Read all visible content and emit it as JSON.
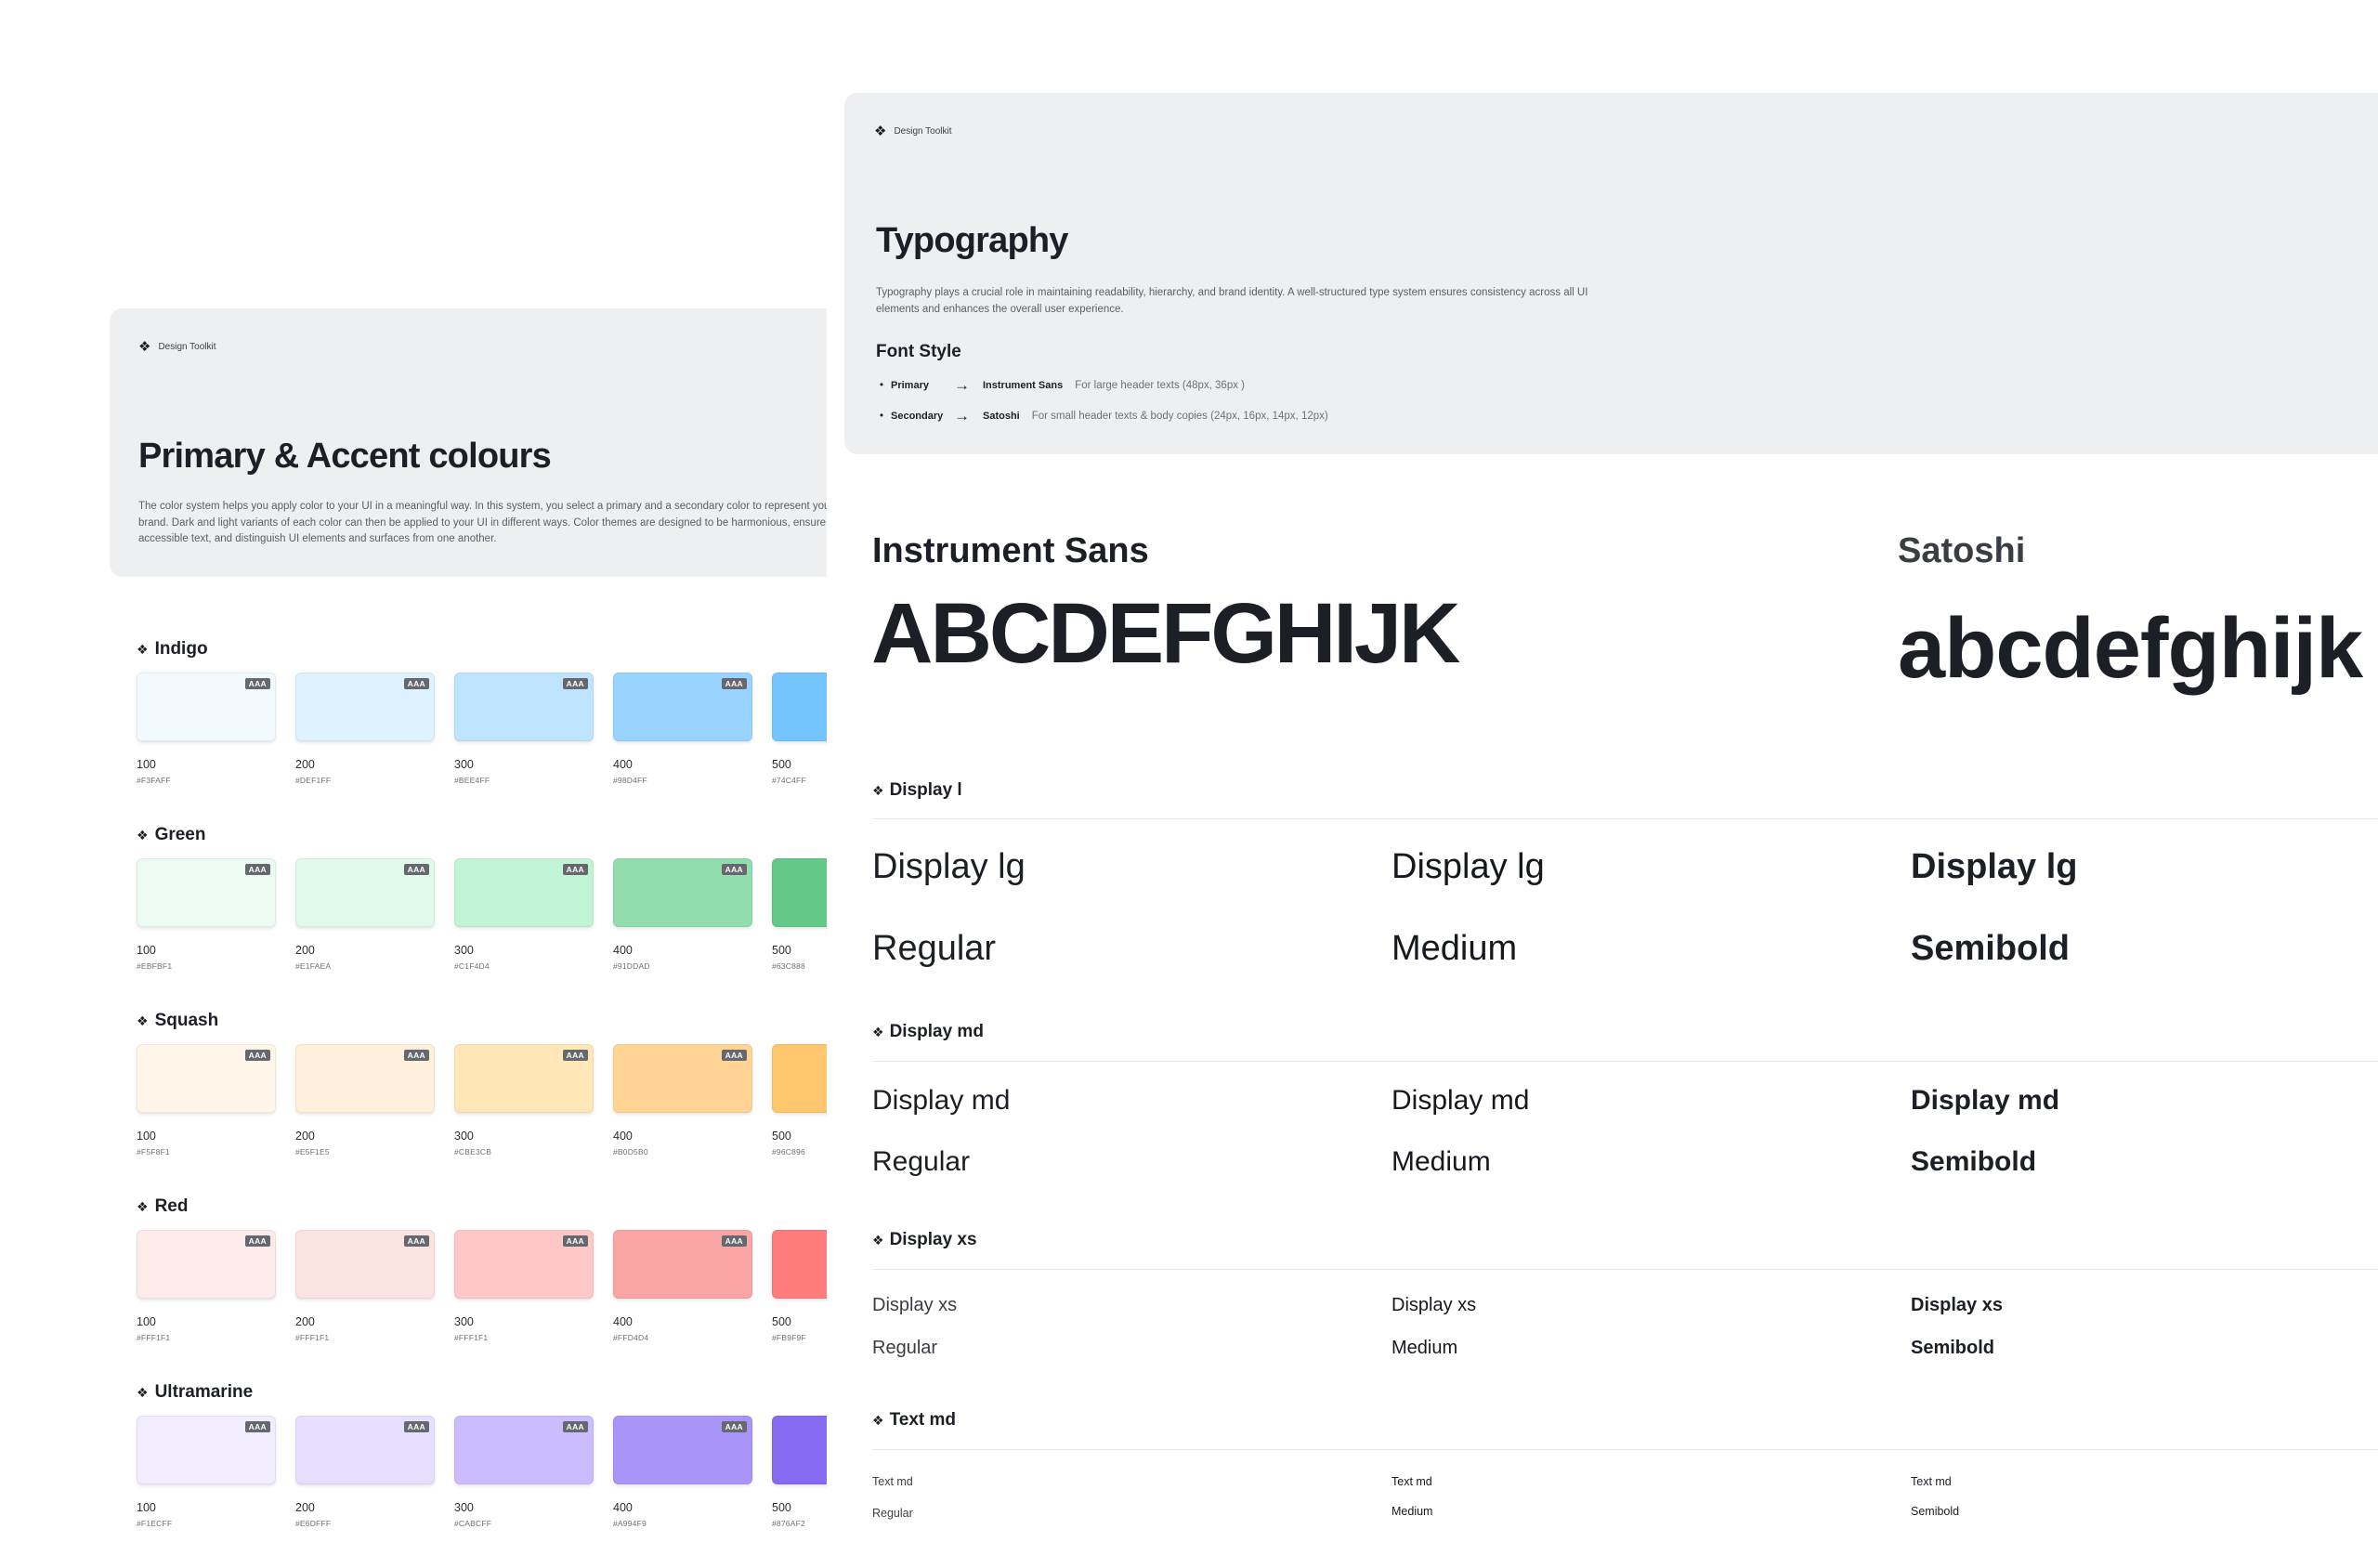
{
  "brand_label": "Design Toolkit",
  "colors_page": {
    "title": "Primary & Accent colours",
    "description": "The color system helps you apply color to your UI in a meaningful way. In this system, you select a primary and a secondary color to represent your brand. Dark and light variants of each color can then be applied to your UI in different ways. Color themes are designed to be harmonious, ensure accessible text, and distinguish UI elements and surfaces from one another.",
    "badge": "AAA",
    "palettes": [
      {
        "name": "Indigo",
        "swatches": [
          {
            "shade": "100",
            "hex": "#F3FAFF",
            "color": "#F3FAFF"
          },
          {
            "shade": "200",
            "hex": "#DEF1FF",
            "color": "#DEF1FF"
          },
          {
            "shade": "300",
            "hex": "#BEE4FF",
            "color": "#BEE4FF"
          },
          {
            "shade": "400",
            "hex": "#98D4FF",
            "color": "#98D4FF"
          },
          {
            "shade": "500",
            "hex": "#74C4FF",
            "color": "#74C4FF"
          }
        ]
      },
      {
        "name": "Green",
        "swatches": [
          {
            "shade": "100",
            "hex": "#EBFBF1",
            "color": "#EBFBF1"
          },
          {
            "shade": "200",
            "hex": "#E1FAEA",
            "color": "#E1FAEA"
          },
          {
            "shade": "300",
            "hex": "#C1F4D4",
            "color": "#C1F4D4"
          },
          {
            "shade": "400",
            "hex": "#91DDAD",
            "color": "#91DDAD"
          },
          {
            "shade": "500",
            "hex": "#63C888",
            "color": "#63C888"
          }
        ]
      },
      {
        "name": "Squash",
        "swatches": [
          {
            "shade": "100",
            "hex": "#F5F8F1",
            "color": "#FFF6E9"
          },
          {
            "shade": "200",
            "hex": "#E5F1E5",
            "color": "#FFF0DB"
          },
          {
            "shade": "300",
            "hex": "#CBE3CB",
            "color": "#FFE7B8"
          },
          {
            "shade": "400",
            "hex": "#B0D5B0",
            "color": "#FFD495"
          },
          {
            "shade": "500",
            "hex": "#96C896",
            "color": "#FFC66E"
          }
        ]
      },
      {
        "name": "Red",
        "swatches": [
          {
            "shade": "100",
            "hex": "#FFF1F1",
            "color": "#FDEBEB"
          },
          {
            "shade": "200",
            "hex": "#FFF1F1",
            "color": "#FDE2E2"
          },
          {
            "shade": "300",
            "hex": "#FFF1F1",
            "color": "#FFC8C8"
          },
          {
            "shade": "400",
            "hex": "#FFD4D4",
            "color": "#F9A5A5"
          },
          {
            "shade": "500",
            "hex": "#FB9F9F",
            "color": "#FF7C7C"
          }
        ]
      },
      {
        "name": "Ultramarine",
        "swatches": [
          {
            "shade": "100",
            "hex": "#F1ECFF",
            "color": "#F1ECFF"
          },
          {
            "shade": "200",
            "hex": "#E6DFFF",
            "color": "#E6DFFF"
          },
          {
            "shade": "300",
            "hex": "#CABCFF",
            "color": "#CABCFF"
          },
          {
            "shade": "400",
            "hex": "#A994F9",
            "color": "#A994F9"
          },
          {
            "shade": "500",
            "hex": "#876AF2",
            "color": "#876AF2"
          }
        ]
      }
    ]
  },
  "typography_page": {
    "title": "Typography",
    "description": "Typography plays a crucial role in maintaining readability, hierarchy, and brand identity. A well-structured type system ensures consistency across all UI elements and enhances the overall user experience.",
    "font_style_heading": "Font Style",
    "font_styles": [
      {
        "role": "Primary",
        "font": "Instrument Sans",
        "usage": "For large header texts (48px, 36px )"
      },
      {
        "role": "Secondary",
        "font": "Satoshi",
        "usage": "For small header texts & body copies (24px, 16px, 14px, 12px)"
      }
    ],
    "samples": {
      "primary_name": "Instrument Sans",
      "primary_glyphs": "ABCDEFGHIJK",
      "secondary_name": "Satoshi",
      "secondary_glyphs": "abcdefghijk"
    },
    "sections": [
      {
        "title": "Display l",
        "samples": [
          {
            "label": "Display lg",
            "weight": "Regular"
          },
          {
            "label": "Display lg",
            "weight": "Medium"
          },
          {
            "label": "Display lg",
            "weight": "Semibold"
          }
        ]
      },
      {
        "title": "Display md",
        "samples": [
          {
            "label": "Display md",
            "weight": "Regular"
          },
          {
            "label": "Display md",
            "weight": "Medium"
          },
          {
            "label": "Display md",
            "weight": "Semibold"
          }
        ]
      },
      {
        "title": "Display xs",
        "samples": [
          {
            "label": "Display xs",
            "weight": "Regular"
          },
          {
            "label": "Display xs",
            "weight": "Medium"
          },
          {
            "label": "Display xs",
            "weight": "Semibold"
          }
        ]
      },
      {
        "title": "Text md",
        "samples": [
          {
            "label": "Text md",
            "weight": "Regular"
          },
          {
            "label": "Text md",
            "weight": "Medium"
          },
          {
            "label": "Text md",
            "weight": "Semibold"
          }
        ]
      }
    ]
  }
}
